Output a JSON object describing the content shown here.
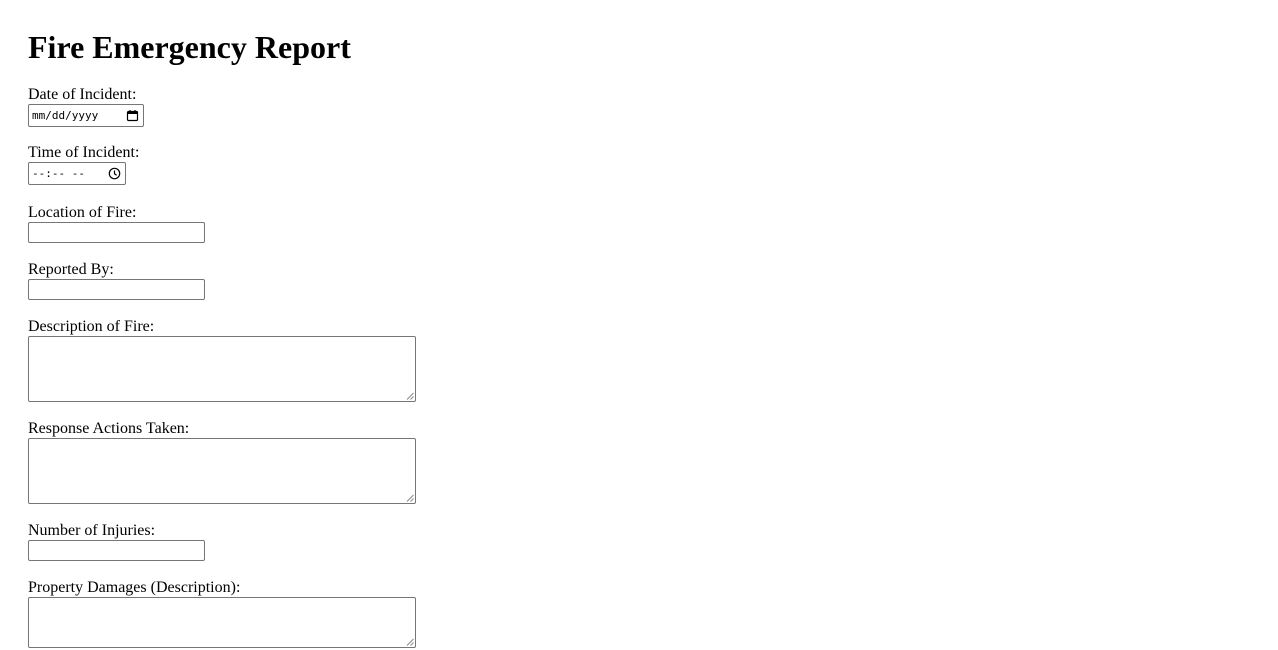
{
  "title": "Fire Emergency Report",
  "fields": {
    "date": {
      "label": "Date of Incident:",
      "placeholder": "mm/dd/yyyy"
    },
    "time": {
      "label": "Time of Incident:",
      "placeholder": "--:-- --"
    },
    "location": {
      "label": "Location of Fire:",
      "value": ""
    },
    "reported_by": {
      "label": "Reported By:",
      "value": ""
    },
    "description": {
      "label": "Description of Fire:",
      "value": ""
    },
    "response": {
      "label": "Response Actions Taken:",
      "value": ""
    },
    "injuries": {
      "label": "Number of Injuries:",
      "value": ""
    },
    "damages": {
      "label": "Property Damages (Description):",
      "value": ""
    }
  },
  "icons": {
    "date_picker": "calendar-icon",
    "time_picker": "clock-icon",
    "resize": "resize-grip-icon"
  }
}
